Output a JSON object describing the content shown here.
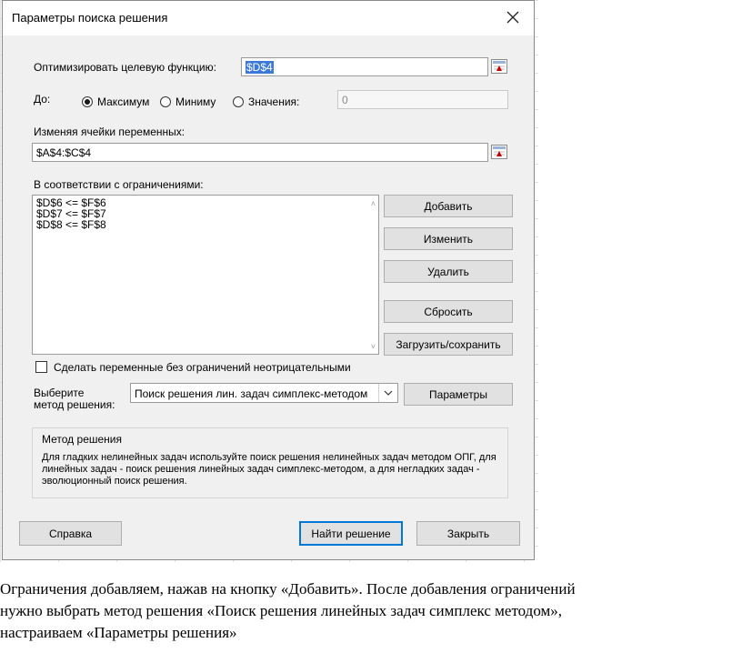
{
  "dialog": {
    "title": "Параметры поиска решения",
    "objective": {
      "label": "Оптимизировать целевую функцию:",
      "value": "$D$4"
    },
    "to": {
      "label": "До:",
      "options": [
        "Максимум",
        "Миниму",
        "Значения:"
      ],
      "selected": "Максимум",
      "value_field": "0"
    },
    "changing_cells": {
      "label": "Изменяя ячейки переменных:",
      "value": "$A$4:$C$4"
    },
    "constraints": {
      "label": "В соответствии с ограничениями:",
      "items": [
        "$D$6 <= $F$6",
        "$D$7 <= $F$7",
        "$D$8 <= $F$8"
      ]
    },
    "buttons": {
      "add": "Добавить",
      "change": "Изменить",
      "delete": "Удалить",
      "reset": "Сбросить",
      "load_save": "Загрузить/сохранить",
      "options": "Параметры",
      "help": "Справка",
      "solve": "Найти решение",
      "close": "Закрыть"
    },
    "nonnegative": {
      "label": "Сделать переменные без ограничений неотрицательными",
      "checked": false
    },
    "method": {
      "label_line1": "Выберите",
      "label_line2": "метод решения:",
      "selected": "Поиск решения лин. задач симплекс-методом"
    },
    "method_box": {
      "title": "Метод решения",
      "description": "Для гладких нелинейных задач используйте поиск решения нелинейных задач методом ОПГ, для линейных задач - поиск решения линейных задач симплекс-методом, а для негладких задач - эволюционный поиск решения."
    }
  },
  "caption": {
    "lines": [
      "Ограничения добавляем, нажав на кнопку «Добавить». После добавления ограничений",
      "нужно выбрать метод решения «Поиск решения линейных задач симплекс методом»,",
      "настраиваем «Параметры решения»"
    ]
  },
  "colors": {
    "selection": "#3b78d8",
    "primary_border": "#0078d7",
    "dialog_bg": "#f0f0f0"
  },
  "icons": [
    "close-icon",
    "collapse-dialog-icon",
    "chevron-up-icon",
    "chevron-down-icon",
    "dropdown-arrow-icon"
  ]
}
